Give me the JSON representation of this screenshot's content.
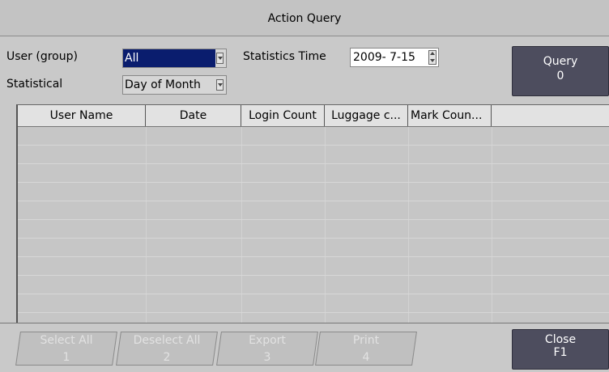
{
  "window": {
    "title": "Action Query"
  },
  "filters": {
    "user_group_label": "User (group)",
    "user_group_value": "All",
    "statistical_label": "Statistical",
    "statistical_value": "Day of Month",
    "statistics_time_label": "Statistics Time",
    "statistics_time_value": "2009-  7-15"
  },
  "query_button": {
    "label": "Query",
    "key": "0"
  },
  "table": {
    "columns": [
      "User Name",
      "Date",
      "Login Count",
      "Luggage c...",
      "Mark Coun...",
      ""
    ],
    "rows": []
  },
  "footer": {
    "buttons": [
      {
        "label": "Select All",
        "key": "1"
      },
      {
        "label": "Deselect All",
        "key": "2"
      },
      {
        "label": "Export",
        "key": "3"
      },
      {
        "label": "Print",
        "key": "4"
      }
    ],
    "close": {
      "label": "Close",
      "key": "F1"
    }
  }
}
